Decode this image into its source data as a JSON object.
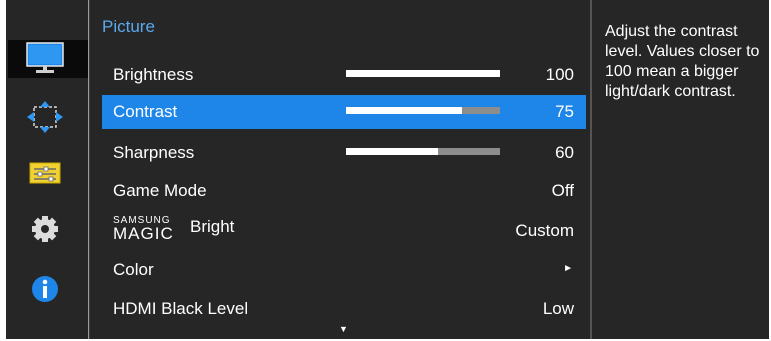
{
  "sidebar": {
    "icons": [
      {
        "name": "picture-icon",
        "selected": true
      },
      {
        "name": "screen-position-icon",
        "selected": false
      },
      {
        "name": "osd-settings-icon",
        "selected": false
      },
      {
        "name": "gear-icon",
        "selected": false
      },
      {
        "name": "info-icon",
        "selected": false
      }
    ]
  },
  "menu": {
    "heading": "Picture",
    "items": [
      {
        "label": "Brightness",
        "value": "100",
        "level": 100
      },
      {
        "label": "Contrast",
        "value": "75",
        "level": 75,
        "selected": true
      },
      {
        "label": "Sharpness",
        "value": "60",
        "level": 60
      },
      {
        "label": "Game Mode",
        "value": "Off"
      },
      {
        "label_small": "SAMSUNG",
        "label_big": "MAGIC",
        "label": "Bright",
        "value": "Custom"
      },
      {
        "label": "Color",
        "value": "►"
      },
      {
        "label": "HDMI Black Level",
        "value": "Low"
      }
    ],
    "scroll_indicator": "▼"
  },
  "help": {
    "text": "Adjust the contrast level. Values closer to 100 mean a bigger light/dark contrast."
  },
  "colors": {
    "accent": "#1f86e9",
    "heading": "#5aa9ee",
    "panel": "#262626",
    "frame": "#555555",
    "bar_fill": "#ffffff",
    "bar_track": "#8d8d8d"
  }
}
